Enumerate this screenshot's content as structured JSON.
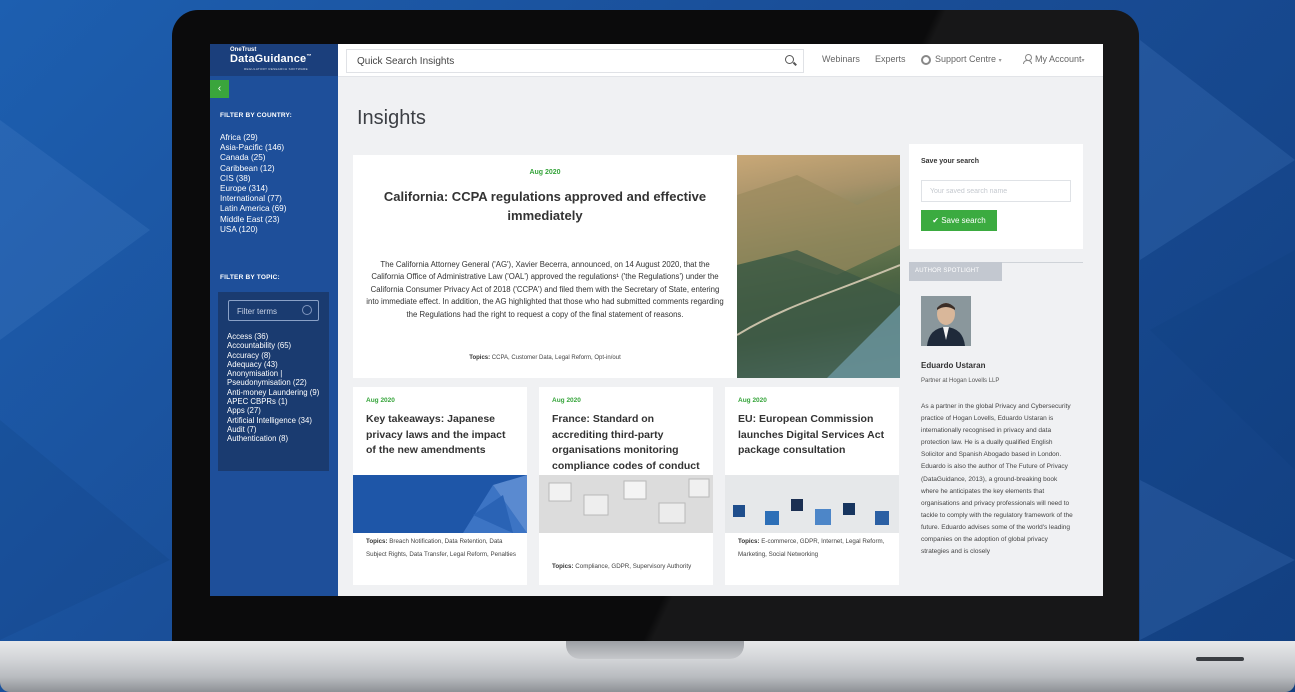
{
  "app": {
    "logo_small": "OneTrust",
    "logo_main": "DataGuidance",
    "logo_tag": "REGULATORY RESEARCH SOFTWARE"
  },
  "sidebar": {
    "collapse_label": "‹",
    "country_heading": "FILTER BY COUNTRY:",
    "countries": [
      "Africa (29)",
      "Asia-Pacific (146)",
      "Canada (25)",
      "Caribbean (12)",
      "CIS (38)",
      "Europe (314)",
      "International (77)",
      "Latin America (69)",
      "Middle East (23)",
      "USA (120)"
    ],
    "topic_heading": "FILTER BY TOPIC:",
    "topic_placeholder": "Filter terms",
    "topics": [
      "Access (36)",
      "Accountability (65)",
      "Accuracy (8)",
      "Adequacy (43)",
      "Anonymisation | Pseudonymisation (22)",
      "Anti-money Laundering (9)",
      "APEC CBPRs (1)",
      "Apps (27)",
      "Artificial Intelligence (34)",
      "Audit (7)",
      "Authentication (8)"
    ]
  },
  "header": {
    "search_placeholder": "Quick Search Insights",
    "nav": {
      "webinars": "Webinars",
      "experts": "Experts",
      "support": "Support Centre",
      "account": "My Account"
    }
  },
  "main": {
    "title": "Insights",
    "featured": {
      "date": "Aug 2020",
      "title": "California: CCPA regulations approved and effective immediately",
      "body": "The California Attorney General ('AG'), Xavier Becerra, announced, on 14 August 2020, that the California Office of Administrative Law ('OAL') approved the regulations¹ ('the Regulations') under the California Consumer Privacy Act of 2018 ('CCPA') and filed them with the Secretary of State, entering into immediate effect. In addition, the AG highlighted that those who had submitted comments regarding the Regulations had the right to request a copy of the final statement of reasons.",
      "topics_label": "Topics:",
      "topics": "CCPA, Customer Data, Legal Reform, Opt-in/out"
    },
    "cards": [
      {
        "date": "Aug 2020",
        "title": "Key takeaways: Japanese privacy laws and the impact of the new amendments",
        "topics_label": "Topics:",
        "topics": "Breach Notification, Data Retention, Data Subject Rights, Data Transfer, Legal Reform, Penalties"
      },
      {
        "date": "Aug 2020",
        "title": "France: Standard on accrediting third-party organisations monitoring compliance codes of conduct",
        "topics_label": "Topics:",
        "topics": "Compliance, GDPR, Supervisory Authority"
      },
      {
        "date": "Aug 2020",
        "title": "EU: European Commission launches Digital Services Act package consultation",
        "topics_label": "Topics:",
        "topics": "E-commerce, GDPR, Internet, Legal Reform, Marketing, Social Networking"
      }
    ]
  },
  "save_search": {
    "title": "Save your search",
    "placeholder": "Your saved search name",
    "button": "✔ Save search"
  },
  "author": {
    "tab": "AUTHOR SPOTLIGHT",
    "name": "Eduardo Ustaran",
    "role": "Partner at Hogan Lovells LLP",
    "bio": "As a partner in the global Privacy and Cybersecurity practice of Hogan Lovells, Eduardo Ustaran is internationally recognised in privacy and data protection law. He is a dually qualified English Solicitor and Spanish Abogado based in London. Eduardo is also the author of The Future of Privacy (DataGuidance, 2013), a ground-breaking book where he anticipates the key elements that organisations and privacy professionals will need to tackle to comply with the regulatory framework of the future. Eduardo advises some of the world's leading companies on the adoption of global privacy strategies and is closely"
  },
  "colors": {
    "sidebar": "#1e4f9a",
    "accent_green": "#3bab40",
    "background_blue": "#1a4f99"
  }
}
